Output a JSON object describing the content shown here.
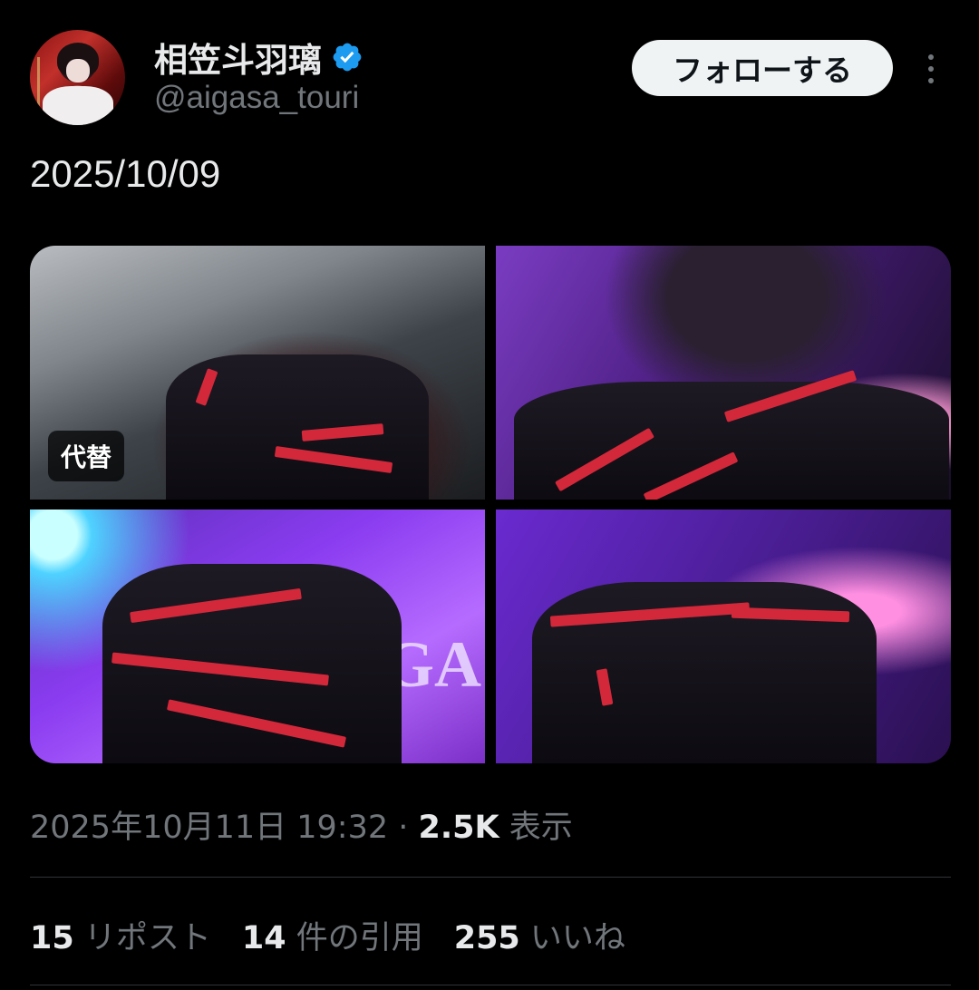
{
  "author": {
    "display_name": "相笠斗羽璃",
    "handle": "@aigasa_touri",
    "verified_icon": "verified-badge-icon",
    "verified_color": "#1d9bf0"
  },
  "header": {
    "follow_label": "フォローする",
    "more_icon": "more-vertical-icon"
  },
  "tweet": {
    "text": "2025/10/09",
    "media": {
      "count": 4,
      "alt_badge_label": "代替",
      "logo_text": "GA"
    },
    "timestamp": "2025年10月11日 19:32",
    "separator": " · ",
    "views_count": "2.5K",
    "views_label": " 表示"
  },
  "stats": {
    "reposts_count": "15",
    "reposts_label": " リポスト",
    "quotes_count": "14",
    "quotes_label": " 件の引用",
    "likes_count": "255",
    "likes_label": " いいね"
  },
  "colors": {
    "background": "#000000",
    "text_primary": "#e7e9ea",
    "text_secondary": "#71767b",
    "divider": "#2f3336",
    "follow_button_bg": "#eff3f4"
  }
}
